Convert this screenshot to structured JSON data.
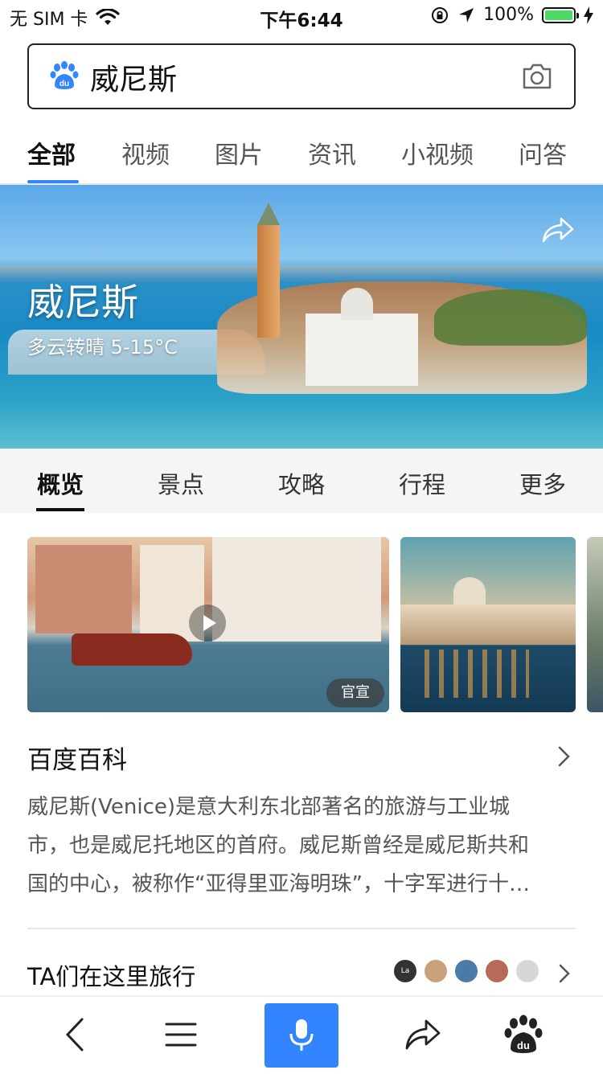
{
  "status_bar": {
    "carrier": "无 SIM 卡",
    "time": "下午6:44",
    "battery": "100%"
  },
  "search": {
    "query": "威尼斯"
  },
  "top_tabs": [
    "全部",
    "视频",
    "图片",
    "资讯",
    "小视频",
    "问答"
  ],
  "top_tabs_active": "全部",
  "hero": {
    "title": "威尼斯",
    "weather": "多云转晴 5-15°C"
  },
  "sub_tabs": [
    "概览",
    "景点",
    "攻略",
    "行程",
    "更多"
  ],
  "sub_tabs_active": "概览",
  "media": {
    "video_badge": "官宣"
  },
  "baike": {
    "title": "百度百科",
    "lines": [
      "威尼斯(Venice)是意大利东北部著名的旅游与工业城",
      "市，也是威尼托地区的首府。威尼斯曾经是威尼斯共和",
      "国的中心，被称作“亚得里亚海明珠”，十字军进行十…"
    ]
  },
  "travel": {
    "title": "TA们在这里旅行",
    "first_avatar_text": "La Vita"
  },
  "colors": {
    "accent": "#3385ff",
    "battery": "#4cd964"
  }
}
